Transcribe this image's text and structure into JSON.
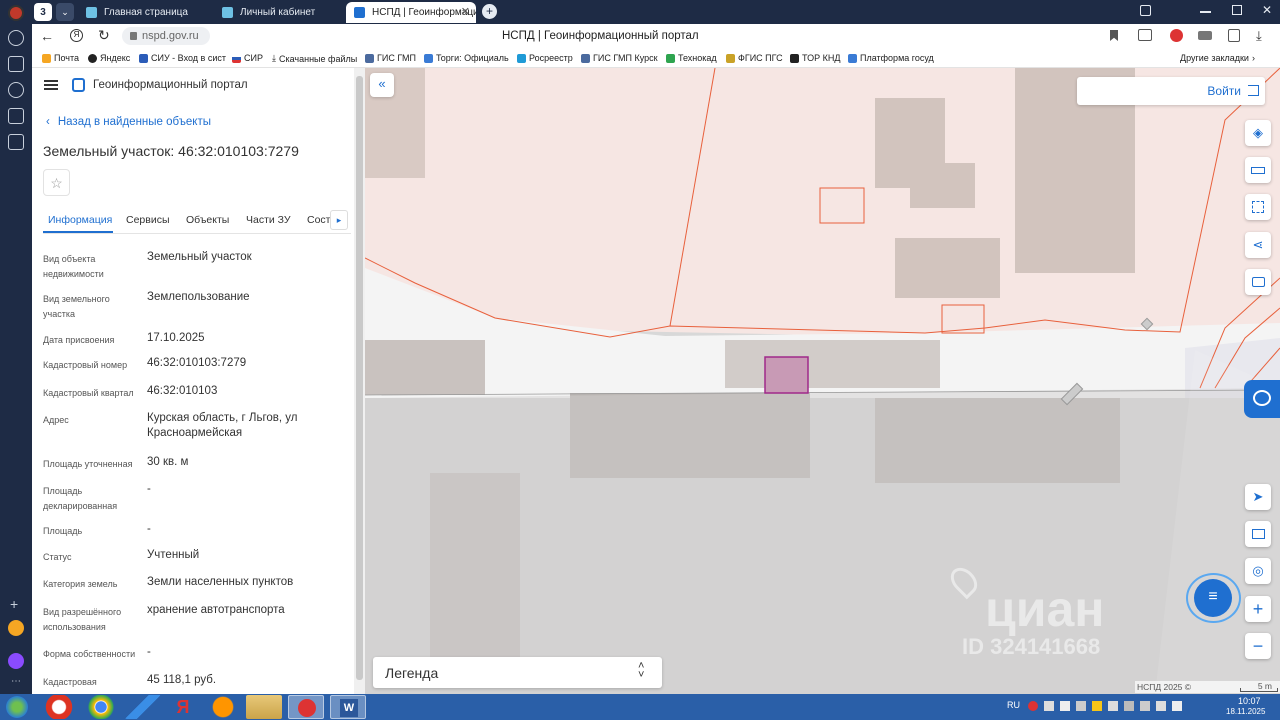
{
  "browser": {
    "tabs": [
      {
        "label": "Главная страница",
        "active": false
      },
      {
        "label": "Личный кабинет",
        "active": false
      },
      {
        "label": "НСПД | Геоинформаци",
        "active": true
      }
    ],
    "tab_count": "3",
    "url": "nspd.gov.ru",
    "page_title": "НСПД | Геоинформационный портал",
    "bookmarks": [
      "Почта",
      "Яндекс",
      "СИУ - Вход в сист",
      "СИР",
      "Скачанные файлы",
      "ГИС ГМП",
      "Торги: Официаль",
      "Росреестр",
      "ГИС ГМП Курск",
      "Технокад",
      "ФГИС ПГС",
      "ТОР КНД",
      "Платформа госуд"
    ],
    "other_bookmarks": "Другие закладки"
  },
  "portal": {
    "name": "Геоинформационный портал",
    "back_link": "Назад в найденные объекты",
    "title": "Земельный участок: 46:32:010103:7279",
    "tabs": [
      "Информация",
      "Сервисы",
      "Объекты",
      "Части ЗУ",
      "Соста"
    ],
    "fields": [
      {
        "label": "Вид объекта недвижимости",
        "value": "Земельный участок"
      },
      {
        "label": "Вид земельного участка",
        "value": "Землепользование"
      },
      {
        "label": "Дата присвоения",
        "value": "17.10.2025"
      },
      {
        "label": "Кадастровый номер",
        "value": "46:32:010103:7279"
      },
      {
        "label": "Кадастровый квартал",
        "value": "46:32:010103"
      },
      {
        "label": "Адрес",
        "value": "Курская область, г Льгов, ул Красноармейская"
      },
      {
        "label": "Площадь уточненная",
        "value": "30 кв. м"
      },
      {
        "label": "Площадь декларированная",
        "value": "-"
      },
      {
        "label": "Площадь",
        "value": "-"
      },
      {
        "label": "Статус",
        "value": "Учтенный"
      },
      {
        "label": "Категория земель",
        "value": "Земли населенных пунктов"
      },
      {
        "label": "Вид разрешённого использования",
        "value": "хранение автотранспорта"
      },
      {
        "label": "Форма собственности",
        "value": "-"
      },
      {
        "label": "Кадастровая",
        "value": "45 118,1 руб."
      }
    ]
  },
  "map": {
    "login": "Войти",
    "legend": "Легенда",
    "watermark": "циан",
    "watermark_id": "ID 324141668",
    "copyright": "НСПД 2025 ©",
    "scale": "5 m",
    "colors": {
      "parcel_line": "#e8603c",
      "selected": "#a0298a",
      "accent": "#1f6fd0"
    }
  },
  "taskbar": {
    "lang": "RU",
    "time": "10:07",
    "date": "18.11.2025"
  }
}
